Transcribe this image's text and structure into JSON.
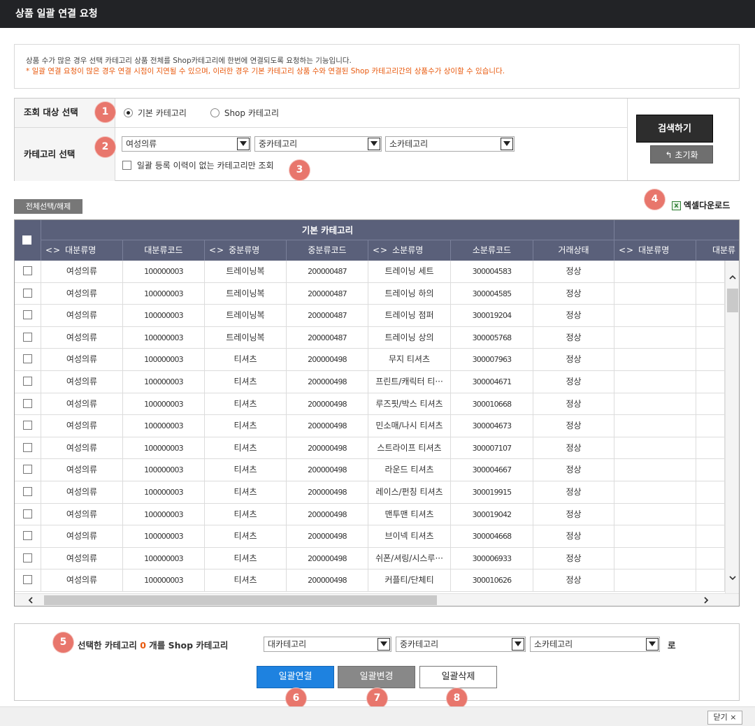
{
  "window": {
    "title": "상품 일괄 연결 요청"
  },
  "notice": {
    "line1": "상품 수가 많은 경우 선택 카테고리 상품 전체를 Shop카테고리에 한번에 연결되도록 요청하는 기능입니다.",
    "line2": "* 일괄 연결 요청이 많은 경우 연결 시점이 지연될 수 있으며, 이러한 경우 기본 카테고리 상품 수와 연결된 Shop 카테고리간의 상품수가 상이할 수 있습니다."
  },
  "search": {
    "target_label": "조회 대상 선택",
    "radio_basic": "기본 카테고리",
    "radio_shop": "Shop 카테고리",
    "radio_selected": "기본 카테고리",
    "category_label": "카테고리 선택",
    "large_value": "여성의류",
    "mid_value": "중카테고리",
    "small_value": "소카테고리",
    "no_history_label": "일괄 등록 이력이 없는 카테고리만 조회",
    "search_button": "검색하기",
    "reset_button": "↰ 초기화"
  },
  "badges": {
    "b1": "1",
    "b2": "2",
    "b3": "3",
    "b4": "4",
    "b5": "5",
    "b6": "6",
    "b7": "7",
    "b8": "8"
  },
  "toolbar": {
    "select_all": "전체선택/해제",
    "excel": "엑셀다운로드",
    "excel_icon": "excel-icon"
  },
  "grid": {
    "group_header": "기본 카테고리",
    "sort_glyph": "<>",
    "columns": [
      "대분류명",
      "대분류코드",
      "중분류명",
      "중분류코드",
      "소분류명",
      "소분류코드",
      "거래상태",
      "대분류명",
      "대분류"
    ],
    "rows": [
      [
        "여성의류",
        "100000003",
        "트레이닝복",
        "200000487",
        "트레이닝 세트",
        "300004583",
        "정상"
      ],
      [
        "여성의류",
        "100000003",
        "트레이닝복",
        "200000487",
        "트레이닝 하의",
        "300004585",
        "정상"
      ],
      [
        "여성의류",
        "100000003",
        "트레이닝복",
        "200000487",
        "트레이닝 점퍼",
        "300019204",
        "정상"
      ],
      [
        "여성의류",
        "100000003",
        "트레이닝복",
        "200000487",
        "트레이닝 상의",
        "300005768",
        "정상"
      ],
      [
        "여성의류",
        "100000003",
        "티셔츠",
        "200000498",
        "무지 티셔츠",
        "300007963",
        "정상"
      ],
      [
        "여성의류",
        "100000003",
        "티셔츠",
        "200000498",
        "프린트/캐릭터 티···",
        "300004671",
        "정상"
      ],
      [
        "여성의류",
        "100000003",
        "티셔츠",
        "200000498",
        "루즈핏/박스 티셔츠",
        "300010668",
        "정상"
      ],
      [
        "여성의류",
        "100000003",
        "티셔츠",
        "200000498",
        "민소매/나시 티셔츠",
        "300004673",
        "정상"
      ],
      [
        "여성의류",
        "100000003",
        "티셔츠",
        "200000498",
        "스트라이프 티셔츠",
        "300007107",
        "정상"
      ],
      [
        "여성의류",
        "100000003",
        "티셔츠",
        "200000498",
        "라운드 티셔츠",
        "300004667",
        "정상"
      ],
      [
        "여성의류",
        "100000003",
        "티셔츠",
        "200000498",
        "레이스/펀칭 티셔츠",
        "300019915",
        "정상"
      ],
      [
        "여성의류",
        "100000003",
        "티셔츠",
        "200000498",
        "맨투맨 티셔츠",
        "300019042",
        "정상"
      ],
      [
        "여성의류",
        "100000003",
        "티셔츠",
        "200000498",
        "브이넥 티셔츠",
        "300004668",
        "정상"
      ],
      [
        "여성의류",
        "100000003",
        "티셔츠",
        "200000498",
        "쉬폰/셔링/시스루···",
        "300006933",
        "정상"
      ],
      [
        "여성의류",
        "100000003",
        "티셔츠",
        "200000498",
        "커플티/단체티",
        "300010626",
        "정상"
      ]
    ]
  },
  "bulk": {
    "text_prefix": "선택한 카테고리",
    "count": "0",
    "text_middle": "개를 Shop 카테고리",
    "large_value": "대카테고리",
    "mid_value": "중카테고리",
    "small_value": "소카테고리",
    "suffix": "로",
    "link_button": "일괄연결",
    "change_button": "일괄변경",
    "delete_button": "일괄삭제"
  },
  "footer": {
    "close_button": "닫기 ×"
  },
  "colors": {
    "titlebar": "#222326",
    "accent_orange": "#e8580c",
    "badge": "#e8766c",
    "grid_header": "#5a607a",
    "primary_button": "#1e82e0"
  }
}
